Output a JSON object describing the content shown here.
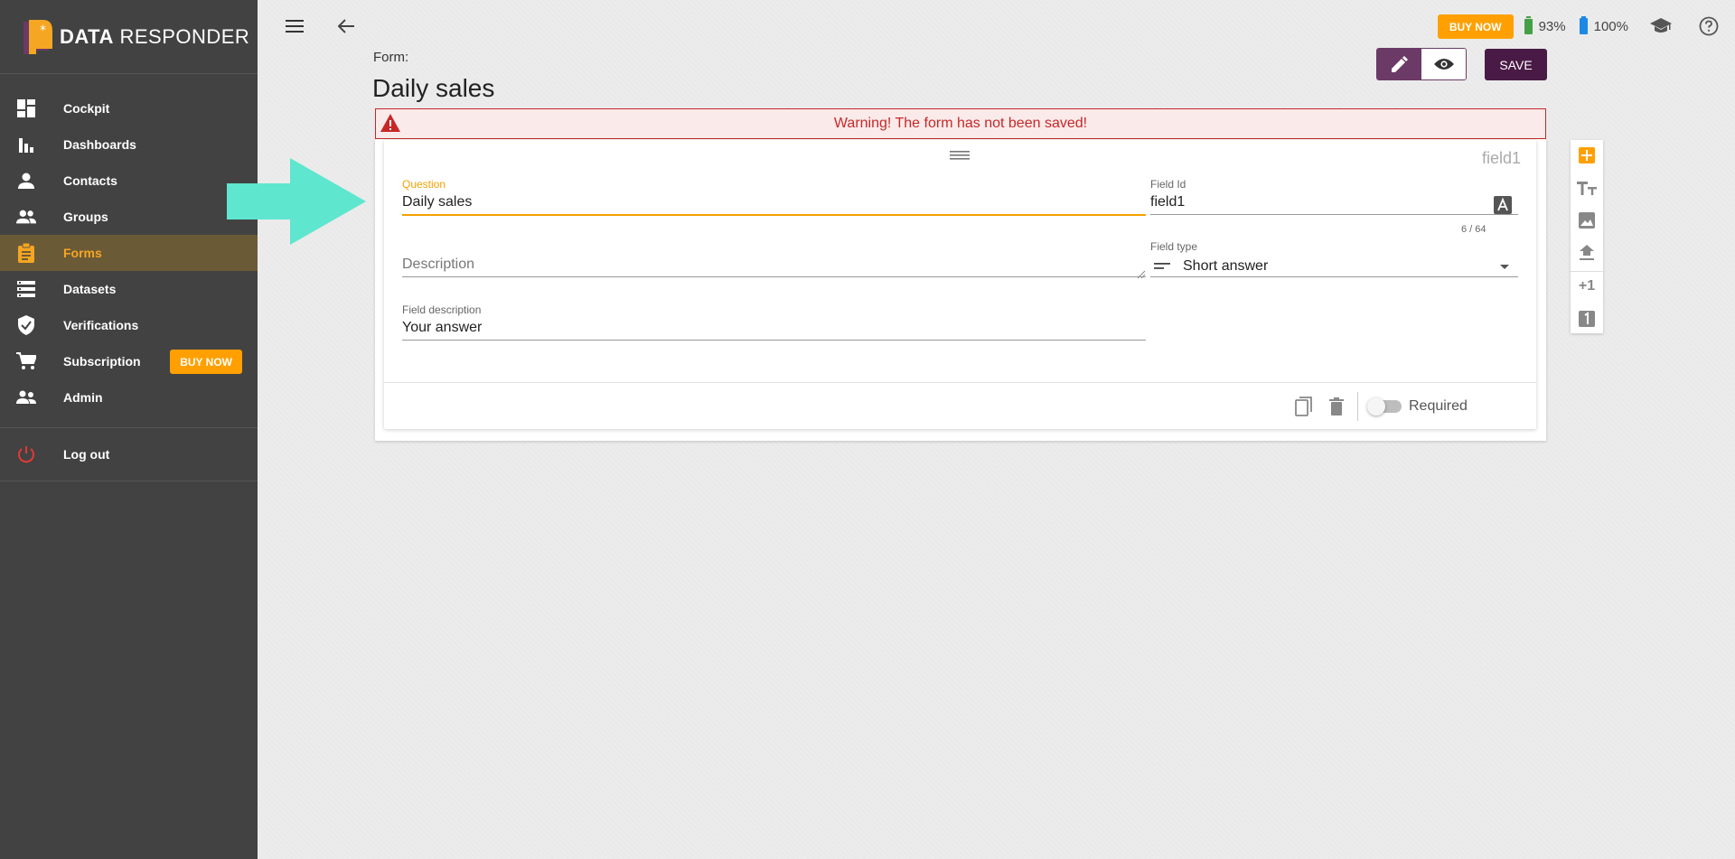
{
  "brand": {
    "name_bold": "DATA",
    "name_rest": " RESPONDER"
  },
  "sidebar": {
    "items": [
      {
        "label": "Cockpit",
        "icon": "dashboard-icon"
      },
      {
        "label": "Dashboards",
        "icon": "bar-chart-icon"
      },
      {
        "label": "Contacts",
        "icon": "person-icon"
      },
      {
        "label": "Groups",
        "icon": "people-icon"
      },
      {
        "label": "Forms",
        "icon": "clipboard-icon",
        "active": true
      },
      {
        "label": "Datasets",
        "icon": "list-icon"
      },
      {
        "label": "Verifications",
        "icon": "shield-check-icon"
      },
      {
        "label": "Subscription",
        "icon": "cart-icon"
      },
      {
        "label": "Admin",
        "icon": "admin-people-icon"
      }
    ],
    "buy_now": "BUY NOW",
    "logout": "Log out"
  },
  "topbar": {
    "buy_now": "BUY NOW",
    "battery1": "93%",
    "battery2": "100%",
    "battery1_level": 0.93,
    "battery2_level": 1.0,
    "battery1_color": "#43a047",
    "battery2_color": "#1e88e5"
  },
  "header": {
    "label": "Form:",
    "title": "Daily sales",
    "save": "SAVE"
  },
  "warning": "Warning! The form has not been saved!",
  "field": {
    "tag": "field1",
    "question_label": "Question",
    "question_value": "Daily sales",
    "field_id_label": "Field Id",
    "field_id_value": "field1",
    "counter": "6 / 64",
    "description_placeholder": "Description",
    "field_type_label": "Field type",
    "field_type_value": "Short answer",
    "field_description_label": "Field description",
    "field_description_value": "Your answer",
    "required": "Required"
  },
  "sidetools": {
    "add": "+",
    "plus_one": "+1",
    "one": "1"
  },
  "colors": {
    "accent": "#f5a000",
    "brand_purple": "#6b3a67",
    "save_purple": "#4a1a46",
    "warning": "#c62828",
    "arrow": "#5ee6cf"
  }
}
